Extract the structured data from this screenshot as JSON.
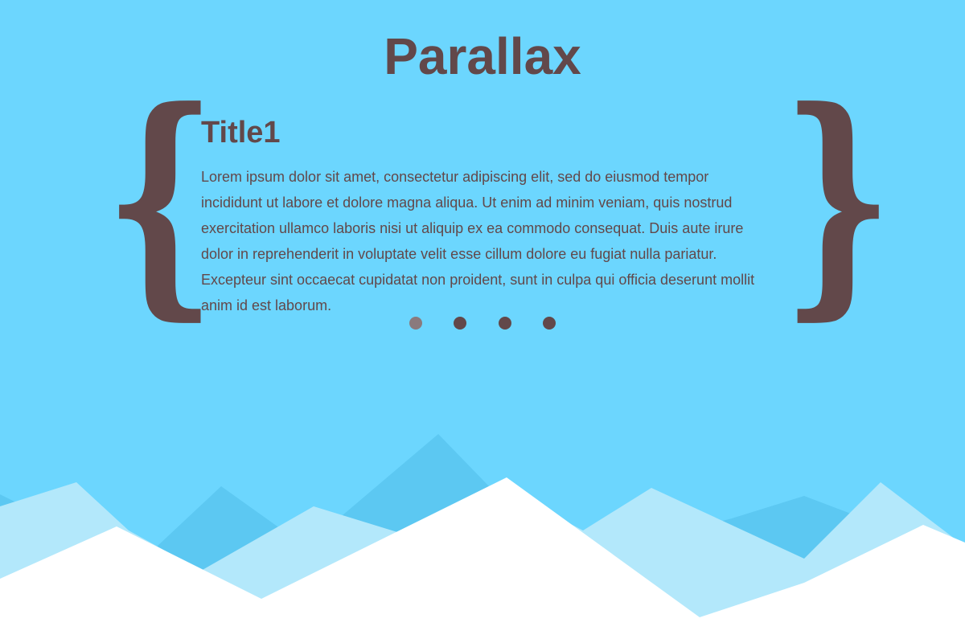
{
  "page": {
    "title": "Parallax"
  },
  "slider": {
    "left_brace": "{",
    "right_brace": "}",
    "active_index": 0,
    "slides": [
      {
        "title": "Title1",
        "text": "Lorem ipsum dolor sit amet, consectetur adipiscing elit, sed do eiusmod tempor incididunt ut labore et dolore magna aliqua. Ut enim ad minim veniam, quis nostrud exercitation ullamco laboris nisi ut aliquip ex ea commodo consequat. Duis aute irure dolor in reprehenderit in voluptate velit esse cillum dolore eu fugiat nulla pariatur. Excepteur sint occaecat cupidatat non proident, sunt in culpa qui officia deserunt mollit anim id est laborum."
      }
    ],
    "dot_count": 4
  },
  "colors": {
    "background": "#6cd6fe",
    "text": "#62484a",
    "dot": "#62484a",
    "dot_active": "#8a7a7d",
    "mountain_back": "#5cc8f2",
    "mountain_mid": "#b3e8fb",
    "mountain_front": "#ffffff"
  }
}
